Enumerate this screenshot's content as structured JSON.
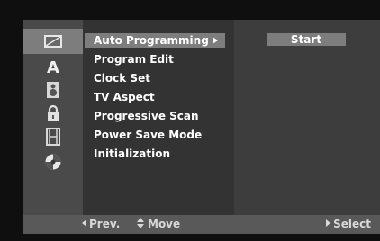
{
  "sidebar": {
    "icons": [
      {
        "name": "tv-setup-icon",
        "active": true
      },
      {
        "name": "language-icon",
        "glyph": "A"
      },
      {
        "name": "audio-speaker-icon"
      },
      {
        "name": "lock-icon"
      },
      {
        "name": "film-icon"
      },
      {
        "name": "disc-icon"
      }
    ]
  },
  "menu": {
    "items": [
      "Auto Programming",
      "Program Edit",
      "Clock Set",
      "TV Aspect",
      "Progressive Scan",
      "Power Save Mode",
      "Initialization"
    ],
    "selected_index": 0
  },
  "submenu": {
    "start_label": "Start"
  },
  "footer": {
    "prev_label": "Prev.",
    "move_label": "Move",
    "select_label": "Select"
  },
  "colors": {
    "background": "#0f0f0f",
    "panel": "#3a3a3a",
    "highlight": "#7d7d7d",
    "footer": "#595959",
    "text": "#ffffff"
  }
}
